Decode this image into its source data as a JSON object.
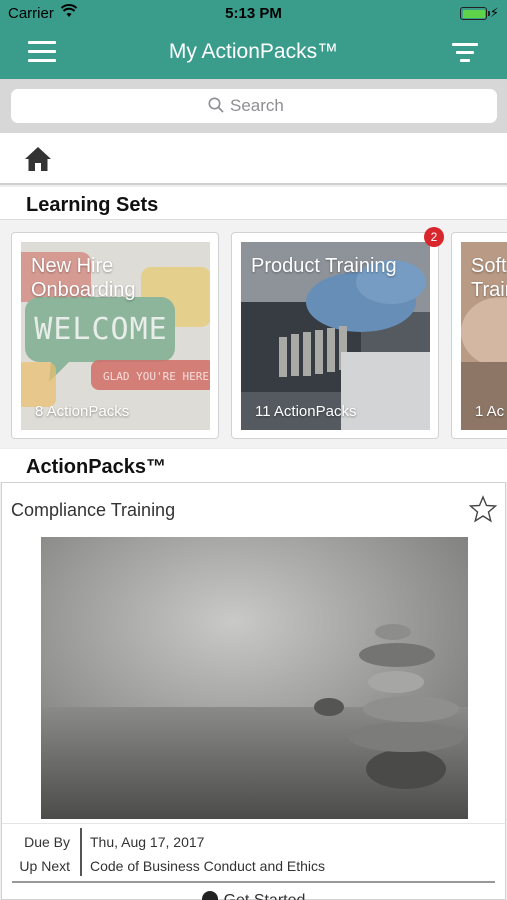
{
  "status": {
    "carrier": "Carrier",
    "time": "5:13 PM"
  },
  "header": {
    "title": "My ActionPacks™"
  },
  "search": {
    "placeholder": "Search"
  },
  "sections": {
    "learning_sets": "Learning Sets",
    "actionpacks": "ActionPacks™"
  },
  "learning_sets": [
    {
      "name": "New Hire Onboarding",
      "count": "8 ActionPacks",
      "image_text": "WELCOME",
      "image_subtext": "GLAD YOU'RE HERE"
    },
    {
      "name": "Product Training",
      "count": "11 ActionPacks",
      "badge": "2"
    },
    {
      "name": "Soft Training",
      "count": "1 Ac"
    }
  ],
  "actionpack": {
    "title": "Compliance Training",
    "due_label": "Due By",
    "due_value": "Thu, Aug 17, 2017",
    "next_label": "Up Next",
    "next_value": "Code of Business Conduct and Ethics",
    "cta": "Get Started"
  },
  "colors": {
    "brand": "#3a9d8c",
    "badge": "#d9262c"
  }
}
